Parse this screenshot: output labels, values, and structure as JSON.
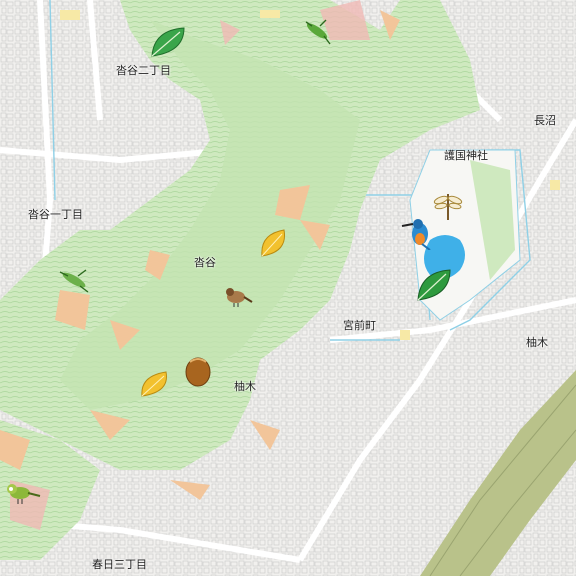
{
  "map": {
    "labels": {
      "hazama2": "沓谷二丁目",
      "hazama1": "沓谷一丁目",
      "hazama": "沓谷",
      "gokoku": "護国神社",
      "naganuma": "長沼",
      "miyamae": "宮前町",
      "yunoki_w": "柚木",
      "yunoki_e": "柚木",
      "kasuga3": "春日三丁目"
    },
    "icons": [
      "leaf-green-icon",
      "grasshopper-icon",
      "leaf-yellow-icon",
      "sparrow-icon",
      "acorn-icon",
      "dragonfly-icon",
      "kingfisher-icon",
      "white-eye-bird-icon"
    ],
    "colors": {
      "forest": "#cfe9bf",
      "forest_dark": "#a9d59a",
      "road": "#ffffff",
      "water": "#6fc8e6",
      "rail": "#b9c28a",
      "pond": "#3fb0e8",
      "orange_patch": "#f2c59a"
    }
  }
}
